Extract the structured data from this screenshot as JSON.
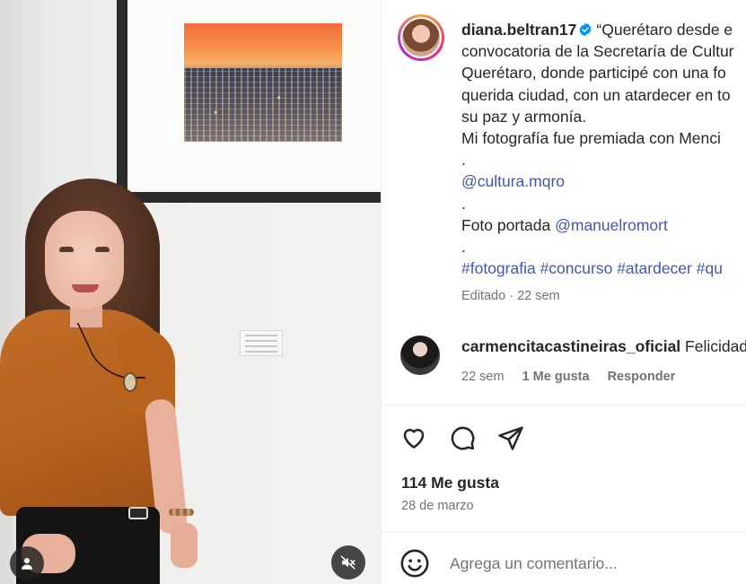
{
  "media": {
    "user_button_icon": "user-icon",
    "mute_button_icon": "volume-muted-icon"
  },
  "post": {
    "username": "diana.beltran17",
    "verified": true,
    "caption_lines": [
      "“Querétaro desde e",
      "convocatoria de la Secretaría de Cultur",
      "Querétaro, donde participé con una fo",
      "querida ciudad, con un atardecer en to",
      "su paz y armonía.",
      "Mi fotografía fue premiada con Menci"
    ],
    "dot1": ".",
    "mention_cultura": "@cultura.mqro",
    "dot2": ".",
    "photo_credit_prefix": "Foto portada ",
    "mention_photo": "@manuelromort",
    "dot3": ".",
    "hashtags": [
      "#fotografia",
      "#concurso",
      "#atardecer",
      "#qu"
    ],
    "edited": "Editado",
    "edited_time": "22 sem"
  },
  "comment": {
    "username": "carmencitacastineiras_oficial",
    "text": "Felicidad",
    "time": "22 sem",
    "likes": "1 Me gusta",
    "reply": "Responder"
  },
  "actions": {
    "like_icon": "heart-icon",
    "comment_icon": "comment-icon",
    "share_icon": "send-icon"
  },
  "stats": {
    "likes": "114 Me gusta",
    "date": "28 de marzo"
  },
  "add_comment": {
    "placeholder": "Agrega un comentario...",
    "emoji_icon": "emoji-icon"
  },
  "colors": {
    "link": "#4257b2",
    "muted_text": "#737373",
    "verified_badge": "#0095f6"
  }
}
